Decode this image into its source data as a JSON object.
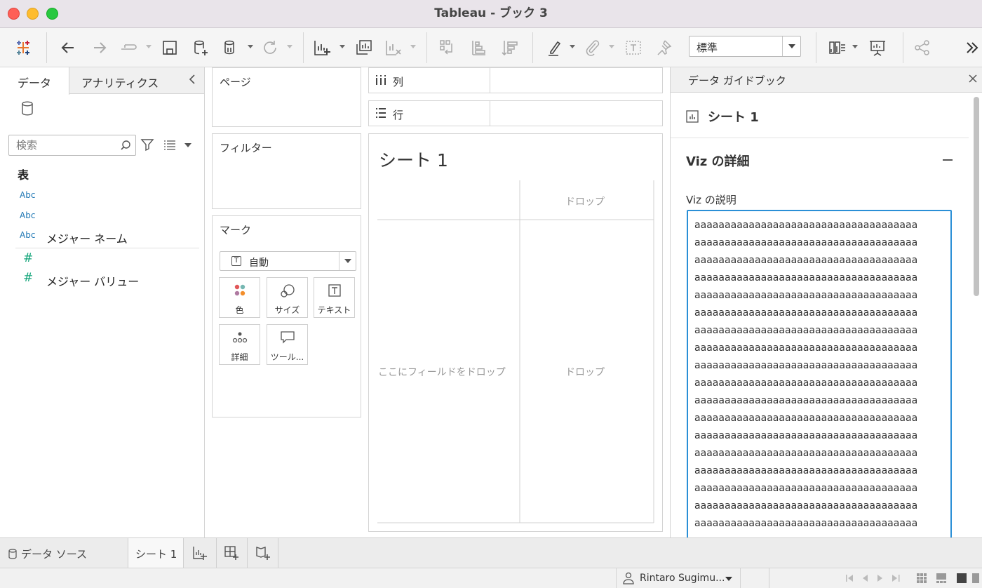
{
  "window": {
    "title": "Tableau - ブック 3"
  },
  "toolbar": {
    "view_mode": "標準"
  },
  "data_pane": {
    "tabs": {
      "data": "データ",
      "analytics": "アナリティクス"
    },
    "search_placeholder": "検索",
    "table_heading": "表",
    "fields": [
      {
        "type_label": "Abc",
        "name": ""
      },
      {
        "type_label": "Abc",
        "name": ""
      },
      {
        "type_label": "Abc",
        "name": "メジャー ネーム"
      },
      {
        "type_label": "#",
        "name": ""
      },
      {
        "type_label": "#",
        "name": "メジャー バリュー"
      }
    ]
  },
  "shelves": {
    "pages": "ページ",
    "filters": "フィルター",
    "marks": {
      "title": "マーク",
      "type": "自動",
      "buttons": {
        "color": "色",
        "size": "サイズ",
        "text": "テキスト",
        "detail": "詳細",
        "tooltip": "ツール..."
      }
    },
    "columns": "列",
    "rows": "行"
  },
  "canvas": {
    "sheet_title": "シート 1",
    "drop_top": "ドロップ",
    "drop_left": "ここにフィールドをドロップ",
    "drop_center": "ドロップ"
  },
  "guide": {
    "title": "データ ガイドブック",
    "sheet": "シート 1",
    "section": "Viz の詳細",
    "description_label": "Viz の説明",
    "description_lines": [
      "aaaaaaaaaaaaaaaaaaaaaaaaaaaaaaaaaaaaa",
      "aaaaaaaaaaaaaaaaaaaaaaaaaaaaaaaaaaaaa",
      "aaaaaaaaaaaaaaaaaaaaaaaaaaaaaaaaaaaaa",
      "aaaaaaaaaaaaaaaaaaaaaaaaaaaaaaaaaaaaa",
      "aaaaaaaaaaaaaaaaaaaaaaaaaaaaaaaaaaaaa",
      "aaaaaaaaaaaaaaaaaaaaaaaaaaaaaaaaaaaaa",
      "aaaaaaaaaaaaaaaaaaaaaaaaaaaaaaaaaaaaa",
      "aaaaaaaaaaaaaaaaaaaaaaaaaaaaaaaaaaaaa",
      "aaaaaaaaaaaaaaaaaaaaaaaaaaaaaaaaaaaaa",
      "aaaaaaaaaaaaaaaaaaaaaaaaaaaaaaaaaaaaa",
      "aaaaaaaaaaaaaaaaaaaaaaaaaaaaaaaaaaaaa",
      "aaaaaaaaaaaaaaaaaaaaaaaaaaaaaaaaaaaaa",
      "aaaaaaaaaaaaaaaaaaaaaaaaaaaaaaaaaaaaa",
      "aaaaaaaaaaaaaaaaaaaaaaaaaaaaaaaaaaaaa",
      "aaaaaaaaaaaaaaaaaaaaaaaaaaaaaaaaaaaaa",
      "aaaaaaaaaaaaaaaaaaaaaaaaaaaaaaaaaaaaa",
      "aaaaaaaaaaaaaaaaaaaaaaaaaaaaaaaaaaaaa",
      "aaaaaaaaaaaaaaaaaaaaaaaaaaaaaaaaaaaaa"
    ]
  },
  "bottom": {
    "data_source_tab": "データ ソース",
    "sheet_tab": "シート 1",
    "user": "Rintaro Sugimu..."
  },
  "icons": {
    "toolbar": [
      "tableau-logo-icon",
      "back-icon",
      "forward-icon",
      "redirect-icon",
      "save-icon",
      "new-datasource-icon",
      "pause-updates-icon",
      "refresh-icon",
      "new-worksheet-icon",
      "duplicate-sheet-icon",
      "clear-sheet-icon",
      "swap-icon",
      "sort-ascending-icon",
      "sort-descending-icon",
      "highlight-icon",
      "group-icon",
      "label-icon",
      "pin-icon",
      "show-me-icon",
      "presentation-icon",
      "share-icon",
      "expand-icon"
    ]
  },
  "colors": {
    "accent": "#2a8fd6",
    "measure": "#13a57a",
    "dimension": "#1f77b4"
  }
}
